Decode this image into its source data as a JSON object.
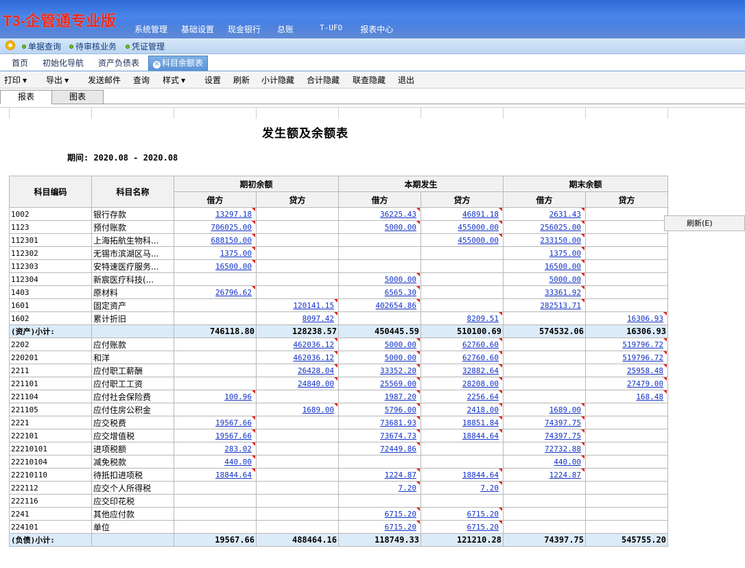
{
  "app": {
    "logo": "T3-企管通专业版"
  },
  "topnav": [
    "系统管理",
    "基础设置",
    "现金银行",
    "总账",
    "T-UFO",
    "报表中心"
  ],
  "quickbar": [
    "单据查询",
    "待审核业务",
    "凭证管理"
  ],
  "pagetabs": {
    "items": [
      "首页",
      "初始化导航",
      "资产负债表"
    ],
    "active": "科目余额表"
  },
  "toolbar": {
    "print": "打印",
    "export": "导出",
    "send_mail": "发送邮件",
    "query": "查询",
    "style": "样式",
    "settings": "设置",
    "refresh": "刷新",
    "hide_subtotal": "小计隐藏",
    "hide_total": "合计隐藏",
    "hide_linked": "联查隐藏",
    "exit": "退出"
  },
  "subtabs": {
    "report": "报表",
    "chart": "图表"
  },
  "report": {
    "title": "发生额及余额表",
    "period": "期间: 2020.08 - 2020.08",
    "headers": {
      "code": "科目编码",
      "name": "科目名称",
      "open": "期初余额",
      "period": "本期发生",
      "close": "期末余额",
      "debit": "借方",
      "credit": "贷方"
    },
    "rows": [
      {
        "code": "1002",
        "name": "银行存款",
        "v": [
          "13297.18",
          "",
          "36225.43",
          "46891.18",
          "2631.43",
          ""
        ]
      },
      {
        "code": "1123",
        "name": "预付账款",
        "v": [
          "706025.00",
          "",
          "5000.00",
          "455000.00",
          "256025.00",
          ""
        ]
      },
      {
        "code": "112301",
        "name": "上海拓航生物科...",
        "v": [
          "688150.00",
          "",
          "",
          "455000.00",
          "233150.00",
          ""
        ]
      },
      {
        "code": "112302",
        "name": "无锡市滨湖区马...",
        "v": [
          "1375.00",
          "",
          "",
          "",
          "1375.00",
          ""
        ]
      },
      {
        "code": "112303",
        "name": "安特速医疗服务...",
        "v": [
          "16500.00",
          "",
          "",
          "",
          "16500.00",
          ""
        ]
      },
      {
        "code": "112304",
        "name": "新宸医疗科技(...",
        "v": [
          "",
          "",
          "5000.00",
          "",
          "5000.00",
          ""
        ]
      },
      {
        "code": "1403",
        "name": "原材料",
        "v": [
          "26796.62",
          "",
          "6565.30",
          "",
          "33361.92",
          ""
        ]
      },
      {
        "code": "1601",
        "name": "固定资产",
        "v": [
          "",
          "120141.15",
          "402654.86",
          "",
          "282513.71",
          ""
        ]
      },
      {
        "code": "1602",
        "name": "累计折旧",
        "v": [
          "",
          "8097.42",
          "",
          "8209.51",
          "",
          "16306.93"
        ]
      },
      {
        "subtotal": true,
        "code": "(资产)小计:",
        "name": "",
        "v": [
          "746118.80",
          "128238.57",
          "450445.59",
          "510100.69",
          "574532.06",
          "16306.93"
        ]
      },
      {
        "code": "2202",
        "name": "应付账款",
        "v": [
          "",
          "462036.12",
          "5000.00",
          "62760.60",
          "",
          "519796.72"
        ]
      },
      {
        "code": "220201",
        "name": "和洋",
        "v": [
          "",
          "462036.12",
          "5000.00",
          "62760.60",
          "",
          "519796.72"
        ]
      },
      {
        "code": "2211",
        "name": "应付职工薪酬",
        "v": [
          "",
          "26428.04",
          "33352.20",
          "32882.64",
          "",
          "25958.48"
        ]
      },
      {
        "code": "221101",
        "name": "应付职工工资",
        "v": [
          "",
          "24840.00",
          "25569.00",
          "28208.00",
          "",
          "27479.00"
        ]
      },
      {
        "code": "221104",
        "name": "应付社会保险费",
        "v": [
          "100.96",
          "",
          "1987.20",
          "2256.64",
          "",
          "168.48"
        ]
      },
      {
        "code": "221105",
        "name": "应付住房公积金",
        "v": [
          "",
          "1689.00",
          "5796.00",
          "2418.00",
          "1689.00",
          ""
        ]
      },
      {
        "code": "2221",
        "name": "应交税费",
        "v": [
          "19567.66",
          "",
          "73681.93",
          "18851.84",
          "74397.75",
          ""
        ]
      },
      {
        "code": "222101",
        "name": "应交增值税",
        "v": [
          "19567.66",
          "",
          "73674.73",
          "18844.64",
          "74397.75",
          ""
        ]
      },
      {
        "code": "22210101",
        "name": "进项税额",
        "v": [
          "283.02",
          "",
          "72449.86",
          "",
          "72732.88",
          ""
        ]
      },
      {
        "code": "22210104",
        "name": "减免税款",
        "v": [
          "440.00",
          "",
          "",
          "",
          "440.00",
          ""
        ]
      },
      {
        "code": "22210110",
        "name": "待抵扣进项税",
        "v": [
          "18844.64",
          "",
          "1224.87",
          "18844.64",
          "1224.87",
          ""
        ]
      },
      {
        "code": "222112",
        "name": "应交个人所得税",
        "v": [
          "",
          "",
          "7.20",
          "7.20",
          "",
          ""
        ]
      },
      {
        "code": "222116",
        "name": "应交印花税",
        "v": [
          "",
          "",
          "",
          "",
          "",
          ""
        ]
      },
      {
        "code": "2241",
        "name": "其他应付款",
        "v": [
          "",
          "",
          "6715.20",
          "6715.20",
          "",
          ""
        ]
      },
      {
        "code": "224101",
        "name": "单位",
        "v": [
          "",
          "",
          "6715.20",
          "6715.20",
          "",
          ""
        ]
      },
      {
        "subtotal": true,
        "code": "(负债)小计:",
        "name": "",
        "v": [
          "19567.66",
          "488464.16",
          "118749.33",
          "121210.28",
          "74397.75",
          "545755.20"
        ]
      }
    ]
  },
  "context_menu": {
    "refresh": "刷新(E)"
  }
}
